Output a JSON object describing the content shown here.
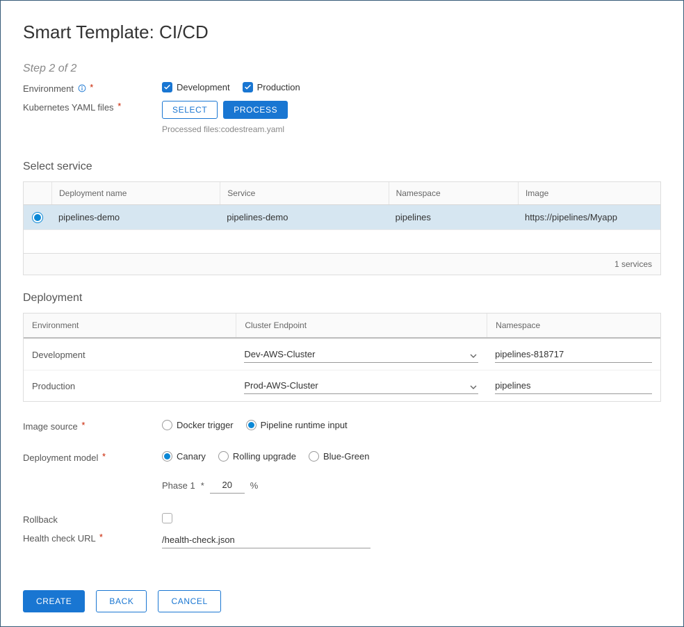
{
  "title": "Smart Template: CI/CD",
  "step": "Step 2 of 2",
  "labels": {
    "environment": "Environment",
    "k8s_yaml": "Kubernetes YAML files",
    "select_service": "Select service",
    "deployment": "Deployment",
    "image_source": "Image source",
    "deployment_model": "Deployment model",
    "rollback": "Rollback",
    "health_check": "Health check URL"
  },
  "environment": {
    "development": {
      "label": "Development",
      "checked": true
    },
    "production": {
      "label": "Production",
      "checked": true
    }
  },
  "yaml": {
    "select_btn": "Select",
    "process_btn": "Process",
    "processed_note": "Processed files:codestream.yaml"
  },
  "service_table": {
    "headers": {
      "deployment_name": "Deployment name",
      "service": "Service",
      "namespace": "Namespace",
      "image": "Image"
    },
    "rows": [
      {
        "selected": true,
        "deployment_name": "pipelines-demo",
        "service": "pipelines-demo",
        "namespace": "pipelines",
        "image": "https://pipelines/Myapp"
      }
    ],
    "footer": "1 services"
  },
  "deployment_table": {
    "headers": {
      "environment": "Environment",
      "cluster_endpoint": "Cluster Endpoint",
      "namespace": "Namespace"
    },
    "rows": [
      {
        "environment": "Development",
        "cluster": "Dev-AWS-Cluster",
        "namespace": "pipelines-818717"
      },
      {
        "environment": "Production",
        "cluster": "Prod-AWS-Cluster",
        "namespace": "pipelines"
      }
    ]
  },
  "image_source": {
    "options": {
      "docker": {
        "label": "Docker trigger",
        "checked": false
      },
      "runtime": {
        "label": "Pipeline runtime input",
        "checked": true
      }
    }
  },
  "deployment_model": {
    "options": {
      "canary": {
        "label": "Canary",
        "checked": true
      },
      "rolling": {
        "label": "Rolling upgrade",
        "checked": false
      },
      "blue_green": {
        "label": "Blue-Green",
        "checked": false
      }
    },
    "phase": {
      "label": "Phase 1",
      "value": "20",
      "unit": "%"
    }
  },
  "rollback_checked": false,
  "health_check_value": "/health-check.json",
  "footer_buttons": {
    "create": "Create",
    "back": "Back",
    "cancel": "Cancel"
  }
}
